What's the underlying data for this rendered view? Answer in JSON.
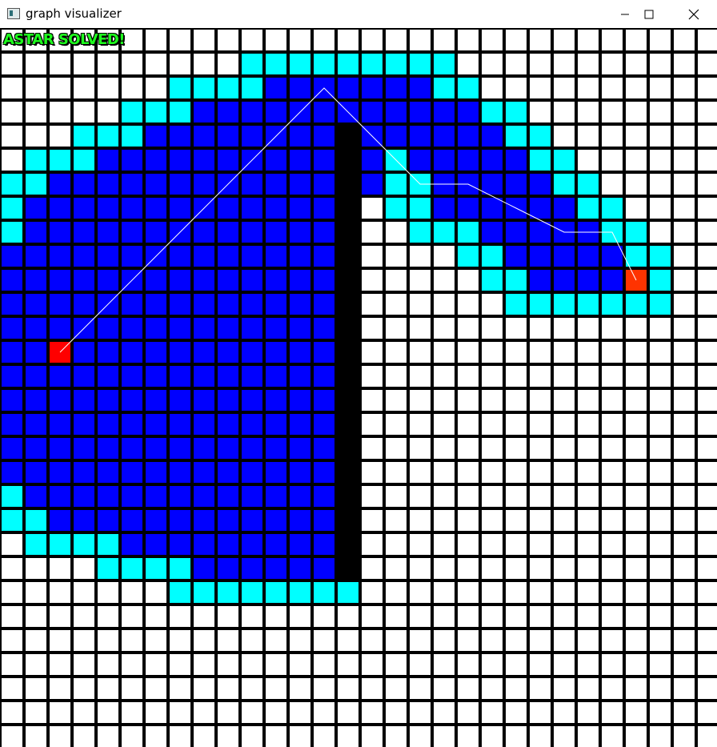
{
  "window": {
    "title": "graph visualizer",
    "minimize_icon": "minimize-icon",
    "maximize_icon": "maximize-icon",
    "close_icon": "close-icon"
  },
  "status": {
    "text": "ASTAR SOLVED!",
    "color": "#1eff1e"
  },
  "grid": {
    "columns": 30,
    "rows": 30,
    "colors": {
      "empty": "#ffffff",
      "frontier": "#00ffff",
      "visited": "#0000ff",
      "wall": "#000000",
      "endpoint_a": "#ff0000",
      "endpoint_b": "#ff3300",
      "path_line": "#ffffff"
    },
    "cells": [
      "..............................",
      "..........FFFFFFFFF...........",
      ".......FFFFVVVVVVVFF..........",
      ".....FFFVVVVVVVVVVVVFF........",
      "...FFFVVVVVVVVWVVVVVVFF.......",
      ".FFFVVVVVVVVVVWVFVVVVVFF......",
      "FFVVVVVVVVVVVVWVFFVVVVVFF.....",
      "FVVVVVVVVVVVVVW.FFVVVVVVFF....",
      "FVVVVVVVVVVVVVW..FFFVVVVVFF...",
      "VVVVVVVVVVVVVVW....FFVVVVVFF..",
      "VVVVVVVVVVVVVVW.....FFVVVVBF..",
      "VVVVVVVVVVVVVVW......FFFFFFF..",
      "VVVVVVVVVVVVVVW...............",
      "VVAVVVVVVVVVVVW...............",
      "VVVVVVVVVVVVVVW...............",
      "VVVVVVVVVVVVVVW...............",
      "VVVVVVVVVVVVVVW...............",
      "VVVVVVVVVVVVVVW...............",
      "VVVVVVVVVVVVVVW...............",
      "FVVVVVVVVVVVVVW...............",
      "FFVVVVVVVVVVVVW...............",
      ".FFFFVVVVVVVVVW...............",
      "....FFFFVVVVVVW...............",
      ".......FFFFFFFF...............",
      "..............................",
      "..............................",
      "..............................",
      "..............................",
      "..............................",
      ".............................."
    ],
    "path": [
      [
        2,
        13
      ],
      [
        13,
        2
      ],
      [
        17,
        6
      ],
      [
        19,
        6
      ],
      [
        21,
        7
      ],
      [
        23,
        8
      ],
      [
        25,
        8
      ],
      [
        26,
        10
      ]
    ]
  }
}
